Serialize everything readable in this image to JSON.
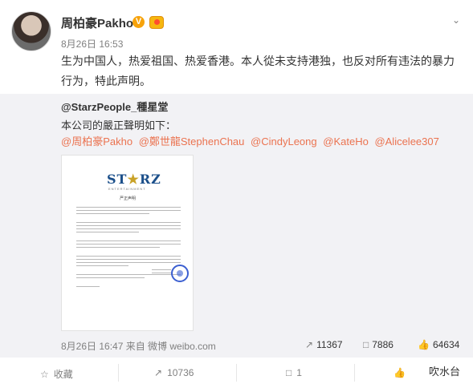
{
  "post": {
    "author": "周柏豪Pakho",
    "verified_badge": "V",
    "date": "8月26日 16:53",
    "text": "生为中国人，热爱祖国、热爱香港。本人從未支持港独，也反对所有违法的暴力行为，特此声明。"
  },
  "repost": {
    "author": "@StarzPeople_種星堂",
    "text": "本公司的嚴正聲明如下：",
    "mentions": [
      "@周柏豪Pakho",
      "@鄭世龍StephenChau",
      "@CindyLeong",
      "@KateHo",
      "@Alicelee307"
    ],
    "doc": {
      "logo": "STARZ",
      "subtitle": "ENTERTAINMENT",
      "heading": "严正声明"
    },
    "meta": "8月26日 16:47 来自 微博 weibo.com",
    "stats": {
      "reposts": "11367",
      "comments": "7886",
      "likes": "64634"
    }
  },
  "actions": {
    "favorite": "收藏",
    "repost": "10736",
    "comment": "1",
    "like": ""
  },
  "watermark": "吹水台",
  "icons": [
    "chevron-down-icon",
    "verified-icon",
    "medal-icon",
    "repost-icon",
    "comment-icon",
    "like-icon",
    "star-icon"
  ]
}
